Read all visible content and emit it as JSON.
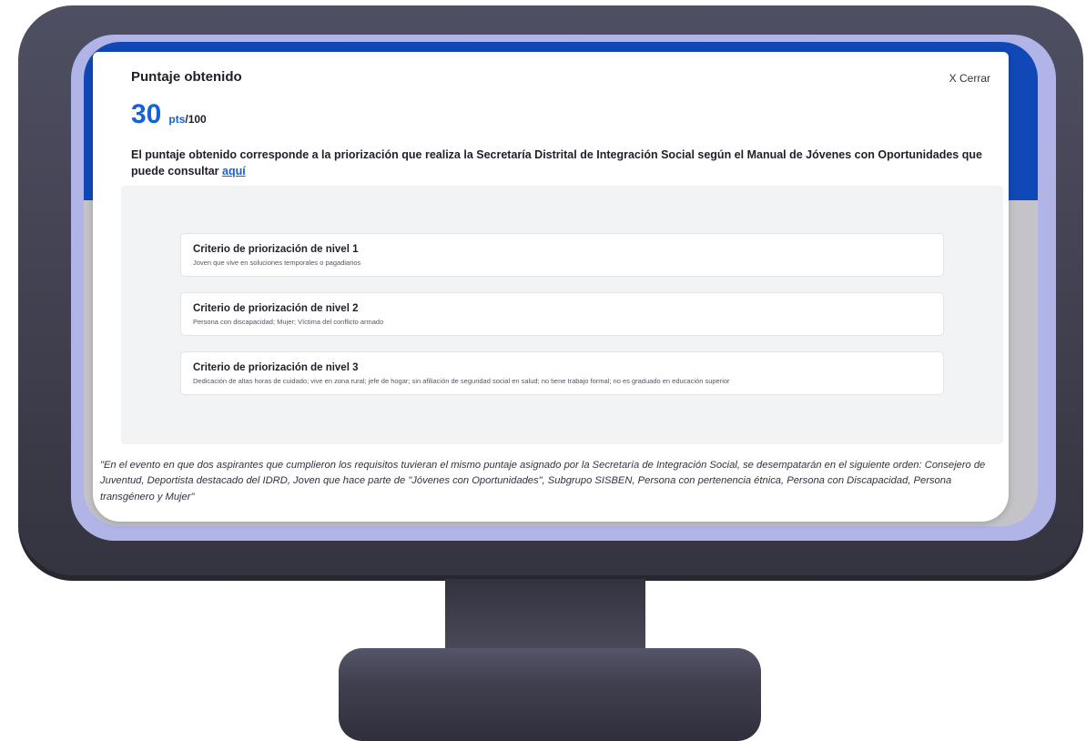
{
  "modal": {
    "title": "Puntaje obtenido",
    "close_label": "X Cerrar",
    "score": {
      "value": "30",
      "unit": "pts",
      "max": "/100"
    },
    "description_text": "El puntaje obtenido corresponde a la priorización que realiza la Secretaría Distrital de Integración Social según el Manual de Jóvenes con Oportunidades que puede consultar ",
    "description_link": "aquí",
    "criteria": [
      {
        "title": "Criterio de priorización de nivel 1",
        "description": "Joven que vive en soluciones temporales o pagadiarios"
      },
      {
        "title": "Criterio de priorización de nivel 2",
        "description": "Persona con discapacidad; Mujer; Víctima del conflicto armado"
      },
      {
        "title": "Criterio de priorización de nivel 3",
        "description": "Dedicación de altas horas de cuidado; vive en zona rural; jefe de hogar; sin afiliación de seguridad social en salud; no tiene trabajo formal; no es graduado en educación superior"
      }
    ],
    "footnote": "\"En el evento en que dos aspirantes que cumplieron los requisitos tuvieran el mismo puntaje asignado por la Secretaría de Integración Social, se desempatarán en el siguiente orden: Consejero de Juventud, Deportista destacado del IDRD, Joven que hace parte de \"Jóvenes con Oportunidades\", Subgrupo SISBEN, Persona con pertenencia étnica, Persona con Discapacidad, Persona transgénero y Mujer\""
  },
  "colors": {
    "accent": "#1462d6",
    "header_blue": "#1148b8",
    "bezel": "#44444f"
  }
}
